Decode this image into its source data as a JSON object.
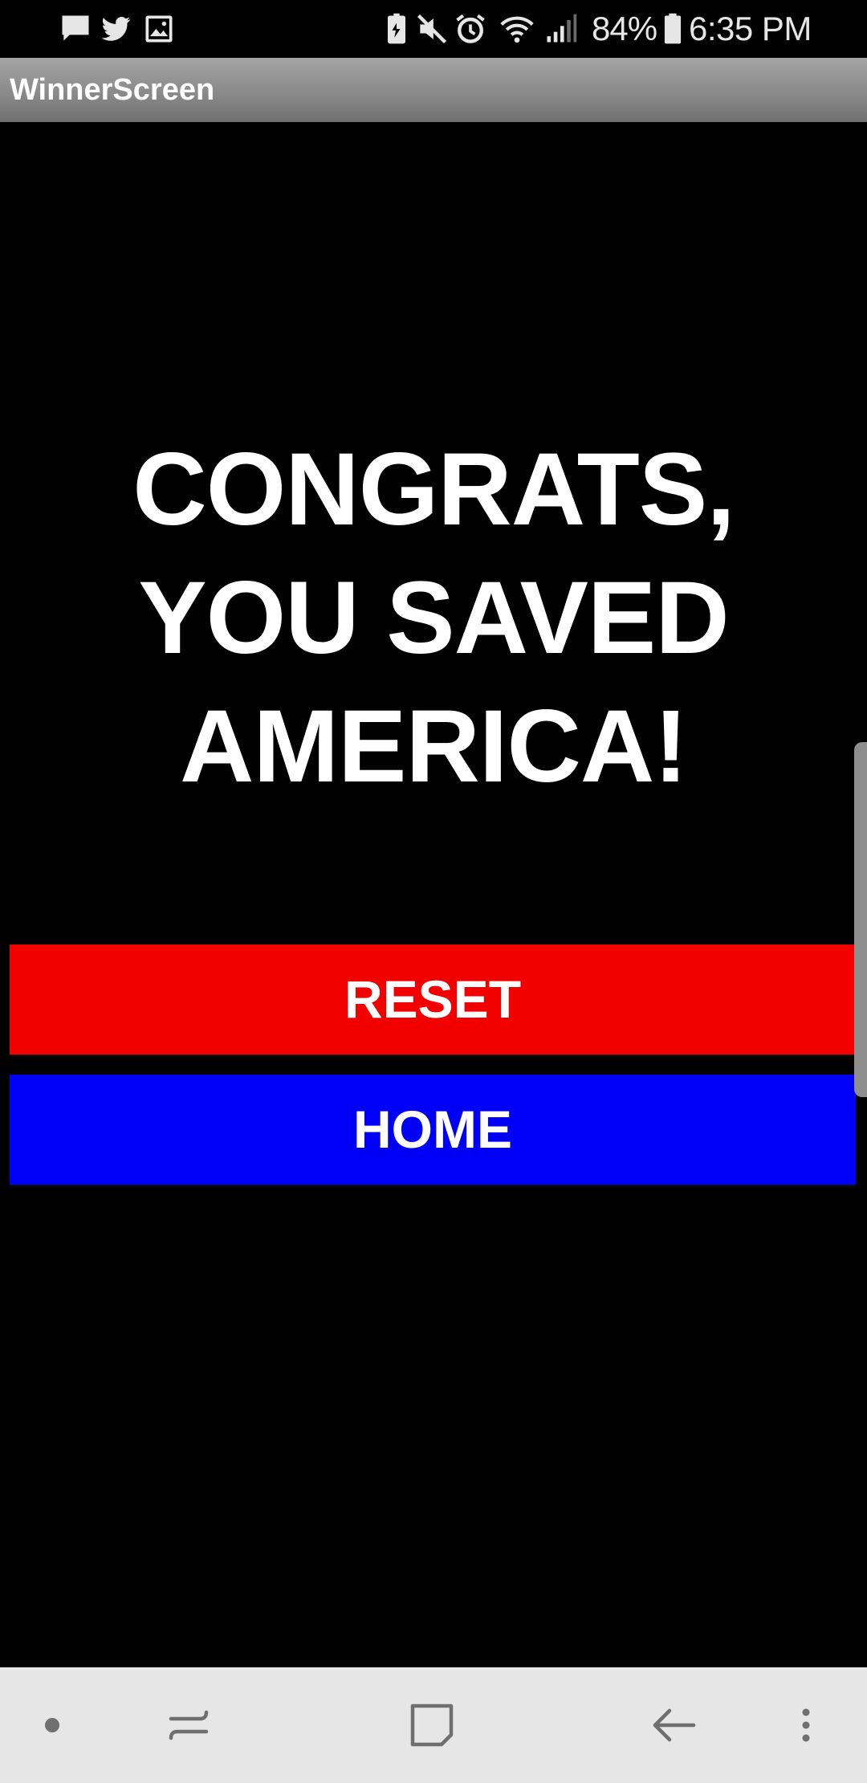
{
  "status_bar": {
    "notification_icons": [
      "message-icon",
      "twitter-icon",
      "image-icon"
    ],
    "system_icons": [
      "battery-saver-icon",
      "mute-icon",
      "alarm-icon",
      "wifi-icon",
      "signal-icon",
      "battery-icon"
    ],
    "battery_percent": "84%",
    "time": "6:35 PM"
  },
  "app_bar": {
    "title": "WinnerScreen"
  },
  "main": {
    "headline_lines": [
      "CONGRATS,",
      "YOU SAVED",
      "AMERICA!"
    ],
    "reset_button": {
      "label": "RESET",
      "color": "#f20000"
    },
    "home_button": {
      "label": "HOME",
      "color": "#0000f6"
    }
  },
  "nav_bar": {
    "buttons": [
      "dot-icon",
      "recent-apps-icon",
      "home-icon",
      "back-icon",
      "more-options-icon"
    ]
  },
  "colors": {
    "background": "#000000",
    "text": "#ffffff",
    "status_text": "#e6e6e6",
    "nav_background": "#e6e6e6"
  }
}
